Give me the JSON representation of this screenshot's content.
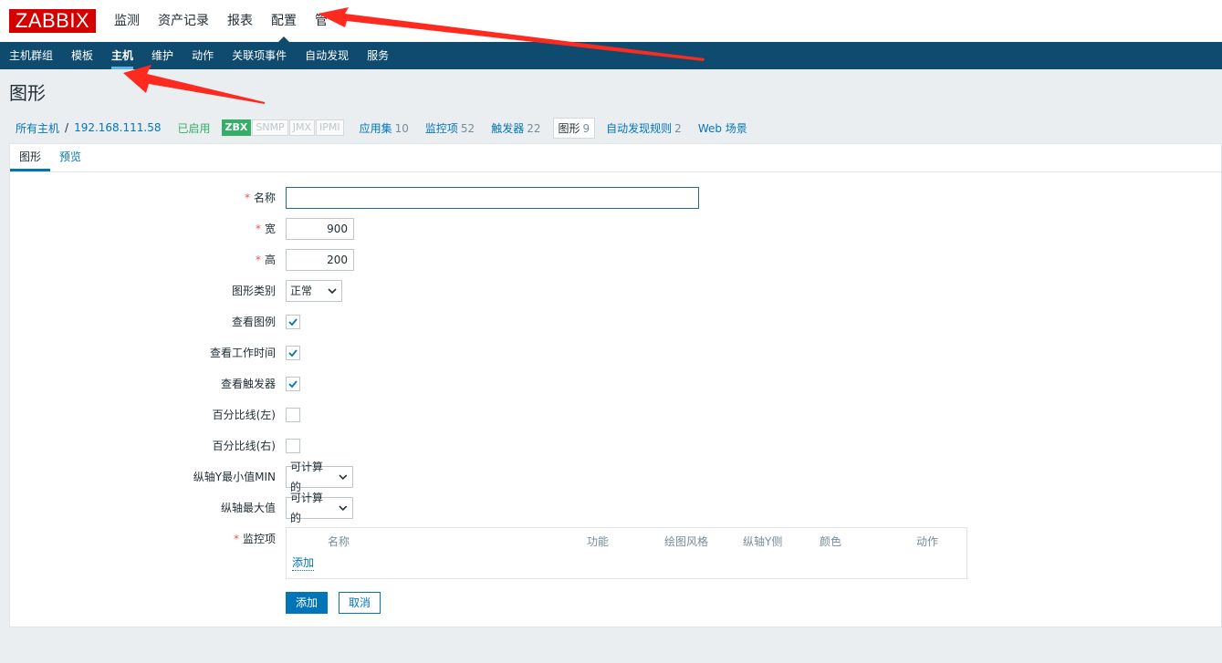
{
  "header": {
    "logo": "ZABBIX",
    "menu": [
      "监测",
      "资产记录",
      "报表",
      "配置",
      "管"
    ]
  },
  "subnav": [
    "主机群组",
    "模板",
    "主机",
    "维护",
    "动作",
    "关联项事件",
    "自动发现",
    "服务"
  ],
  "page": {
    "title": "图形"
  },
  "hostnav": {
    "all_hosts": "所有主机",
    "sep": "/",
    "host": "192.168.111.58",
    "status": "已启用",
    "badges": [
      "ZBX",
      "SNMP",
      "JMX",
      "IPMI"
    ],
    "links": [
      {
        "label": "应用集",
        "count": "10"
      },
      {
        "label": "监控项",
        "count": "52"
      },
      {
        "label": "触发器",
        "count": "22"
      },
      {
        "label": "图形",
        "count": "9"
      },
      {
        "label": "自动发现规则",
        "count": "2"
      },
      {
        "label": "Web 场景",
        "count": ""
      }
    ]
  },
  "tabs": [
    "图形",
    "预览"
  ],
  "form": {
    "required_mark": "*",
    "name_label": "名称",
    "name_value": "",
    "width_label": "宽",
    "width_value": "900",
    "height_label": "高",
    "height_value": "200",
    "graph_type_label": "图形类别",
    "graph_type_value": "正常",
    "show_legend_label": "查看图例",
    "show_legend": true,
    "show_worktime_label": "查看工作时间",
    "show_worktime": true,
    "show_triggers_label": "查看触发器",
    "show_triggers": true,
    "percentile_left_label": "百分比线(左)",
    "percentile_left": false,
    "percentile_right_label": "百分比线(右)",
    "percentile_right": false,
    "ymin_label": "纵轴Y最小值MIN",
    "ymin_value": "可计算的",
    "ymax_label": "纵轴最大值",
    "ymax_value": "可计算的",
    "items_label": "监控项",
    "items_columns": [
      "名称",
      "功能",
      "绘图风格",
      "纵轴Y侧",
      "颜色",
      "动作"
    ],
    "items_add": "添加",
    "submit": "添加",
    "cancel": "取消"
  },
  "colors": {
    "logo": "#d40000",
    "subnav_bg": "#0f4b6e",
    "link": "#0275b8",
    "enabled": "#34af67",
    "annotation_arrow": "#ff2a1f"
  }
}
